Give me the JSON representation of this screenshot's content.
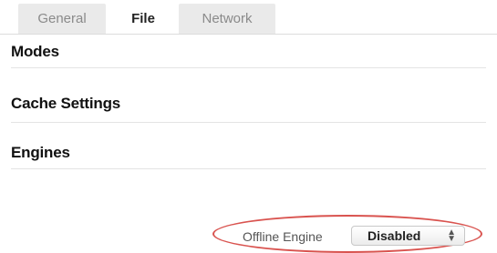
{
  "tabs": [
    {
      "label": "General",
      "active": false
    },
    {
      "label": "File",
      "active": true
    },
    {
      "label": "Network",
      "active": false
    }
  ],
  "sections": {
    "modes": "Modes",
    "cache_settings": "Cache Settings",
    "engines": "Engines"
  },
  "offline_engine": {
    "label": "Offline Engine",
    "selected": "Disabled",
    "highlight_color": "#d9534f"
  },
  "icons": {
    "select_arrows": "up-down-arrows-icon"
  }
}
